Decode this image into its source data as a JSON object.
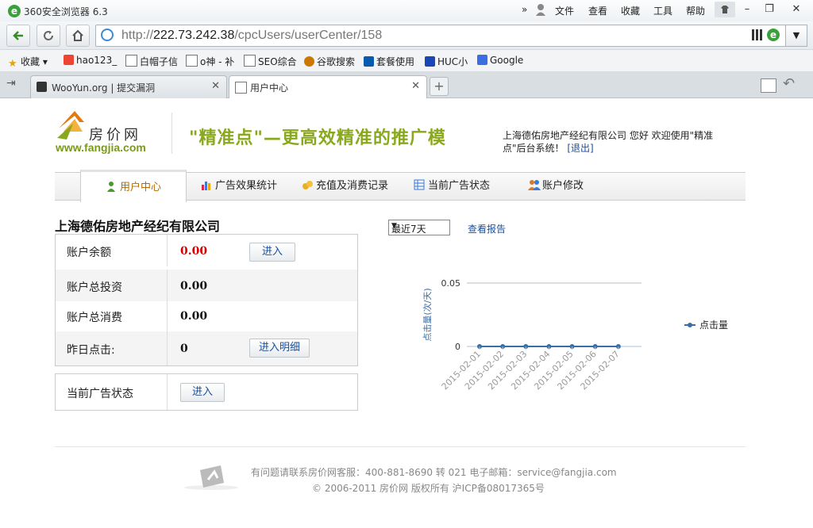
{
  "browser": {
    "title": "360安全浏览器 6.3",
    "menu": [
      "文件",
      "查看",
      "收藏",
      "工具",
      "帮助"
    ],
    "url_scheme": "http://",
    "url_host": "222.73.242.38",
    "url_path": "/cpcUsers/userCenter/158",
    "bookmarks": [
      "收藏",
      "hao123_",
      "白帽子信",
      "o神 - 补",
      "SEO综合",
      "谷歌搜索",
      "套餐使用",
      "HUC小",
      "Google"
    ],
    "tabs": [
      {
        "label": "WooYun.org | 提交漏洞",
        "active": false
      },
      {
        "label": "用户中心",
        "active": true
      }
    ]
  },
  "site": {
    "logo_text": "房价网",
    "logo_url": "www.fangjia.com",
    "slogan": "\"精准点\"—更高效精准的推广模",
    "welcome_prefix": "上海德佑房地产经纪有限公司 您好 欢迎使用\"精准点\"后台系统！",
    "logout": "[退出]",
    "nav": [
      "用户中心",
      "广告效果统计",
      "充值及消费记录",
      "当前广告状态",
      "账户修改"
    ]
  },
  "account": {
    "company": "上海德佑房地产经纪有限公司",
    "rows": [
      {
        "label": "账户余额",
        "value": "0.00",
        "button": "进入"
      },
      {
        "label": "账户总投资",
        "value": "0.00"
      },
      {
        "label": "账户总消费",
        "value": "0.00"
      },
      {
        "label": "昨日点击:",
        "value": "0",
        "button": "进入明细"
      }
    ],
    "ad_status_label": "当前广告状态",
    "ad_status_button": "进入"
  },
  "chart_controls": {
    "range": "最近7天",
    "report_link": "查看报告"
  },
  "chart_data": {
    "type": "line",
    "x": [
      "2015-02-01",
      "2015-02-02",
      "2015-02-03",
      "2015-02-04",
      "2015-02-05",
      "2015-02-06",
      "2015-02-07"
    ],
    "series": [
      {
        "name": "点击量",
        "values": [
          0,
          0,
          0,
          0,
          0,
          0,
          0
        ]
      }
    ],
    "ylabel": "点击量(次/天)",
    "yticks": [
      "0",
      "0.05"
    ],
    "ylim": [
      0,
      0.05
    ],
    "legend": "right",
    "color": "#3b6ea5"
  },
  "footer": {
    "line1": "有问题请联系房价网客服：400-881-8690 转 021 电子邮箱：service@fangjia.com",
    "line2": "© 2006-2011 房价网 版权所有 沪ICP备08017365号"
  }
}
